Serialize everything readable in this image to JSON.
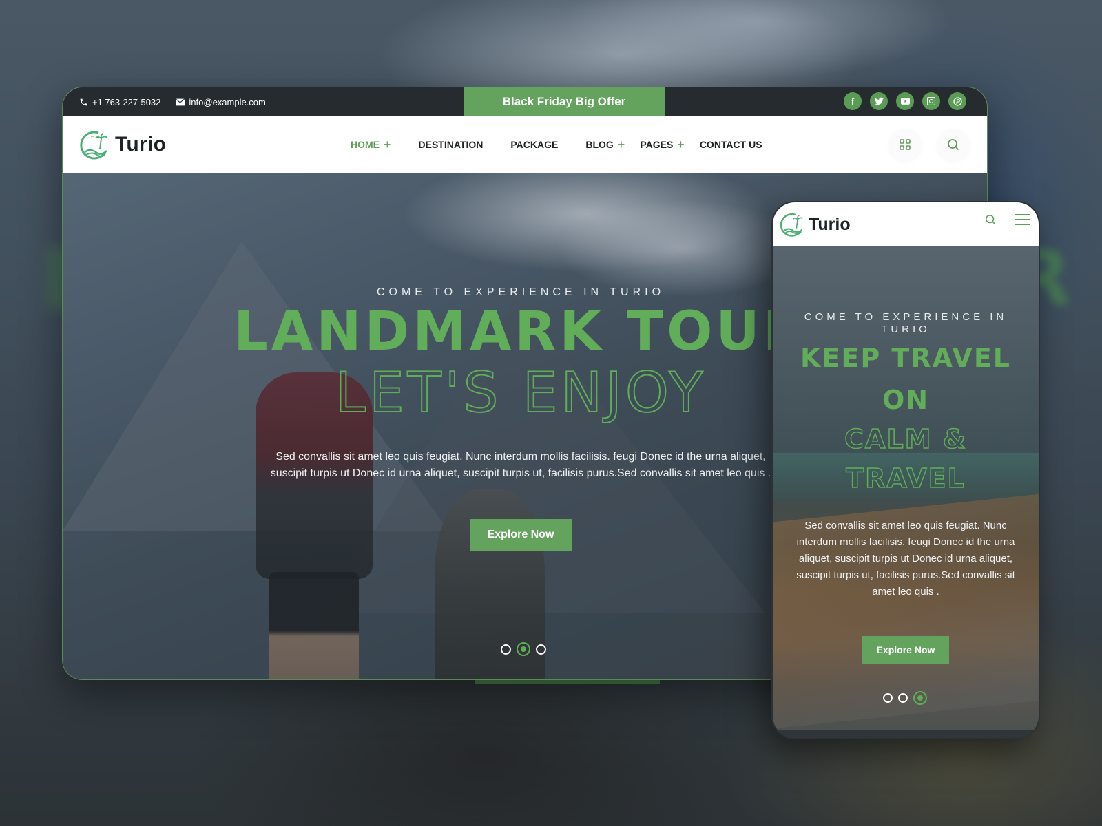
{
  "colors": {
    "accent": "#63a35e",
    "dark": "#262b2f",
    "white": "#ffffff"
  },
  "desktop": {
    "topbar": {
      "phone": "+1 763-227-5032",
      "email": "info@example.com",
      "offer": "Black Friday Big Offer",
      "socials": [
        {
          "name": "facebook",
          "glyph": "f"
        },
        {
          "name": "twitter",
          "glyph": "t"
        },
        {
          "name": "youtube",
          "glyph": "▶"
        },
        {
          "name": "whatsapp",
          "glyph": "✆"
        },
        {
          "name": "pinterest",
          "glyph": "p"
        }
      ]
    },
    "navbar": {
      "logo": "Turio",
      "menu": [
        {
          "label": "HOME",
          "has_submenu": true,
          "active": true
        },
        {
          "label": "DESTINATION",
          "has_submenu": false,
          "active": false
        },
        {
          "label": "PACKAGE",
          "has_submenu": false,
          "active": false
        },
        {
          "label": "BLOG",
          "has_submenu": true,
          "active": false
        },
        {
          "label": "PAGES",
          "has_submenu": true,
          "active": false
        },
        {
          "label": "CONTACT US",
          "has_submenu": false,
          "active": false
        }
      ],
      "plus": "+",
      "icons": [
        "grid-icon",
        "search-icon"
      ]
    },
    "hero": {
      "subtitle": "COME TO EXPERIENCE IN TURIO",
      "title": "LANDMARK TOUR",
      "title_outline": "LET'S ENJOY",
      "description": "Sed convallis sit amet leo quis feugiat. Nunc interdum mollis facilisis. feugi Donec id the urna aliquet, suscipit turpis ut Donec id urna aliquet, suscipit turpis ut, facilisis purus.Sed convallis sit amet leo quis .",
      "button": "Explore Now",
      "slides": 3,
      "active_slide": 2
    }
  },
  "mobile": {
    "logo": "Turio",
    "icons": [
      "search-icon",
      "hamburger-menu-icon"
    ],
    "hero": {
      "subtitle": "COME TO EXPERIENCE IN TURIO",
      "title_line1": "KEEP TRAVEL",
      "title_line2": "ON",
      "title_outline_line1": "CALM &",
      "title_outline_line2": "TRAVEL",
      "description": "Sed convallis sit amet leo quis feugiat. Nunc interdum mollis facilisis. feugi Donec id the urna aliquet, suscipit turpis ut Donec id urna aliquet, suscipit turpis ut, facilisis purus.Sed convallis sit amet leo quis .",
      "button": "Explore Now",
      "slides": 3,
      "active_slide": 3
    }
  },
  "background": {
    "ghost_text": "R"
  }
}
